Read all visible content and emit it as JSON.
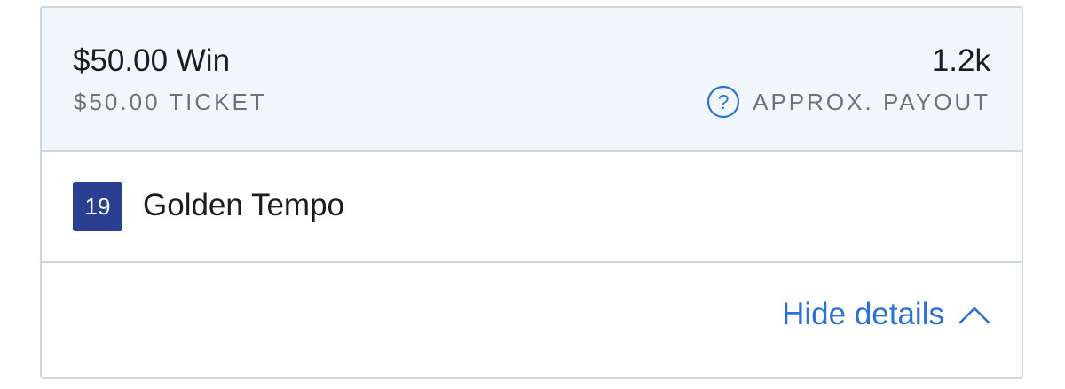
{
  "bet": {
    "title": "$50.00 Win",
    "ticket_label": "$50.00 TICKET"
  },
  "payout": {
    "value": "1.2k",
    "label": "APPROX. PAYOUT",
    "help_icon": "question-circle-icon"
  },
  "runner": {
    "number": "19",
    "name": "Golden Tempo",
    "saddle_cloth_color": "#2a3f8f"
  },
  "details": {
    "label": "Hide details",
    "toggle_icon": "chevron-up-icon"
  },
  "colors": {
    "header_bg": "#f1f6fc",
    "border": "#cfd6de",
    "link": "#2d72d2",
    "muted_text": "#6e7278",
    "primary_text": "#1c1c1c"
  }
}
